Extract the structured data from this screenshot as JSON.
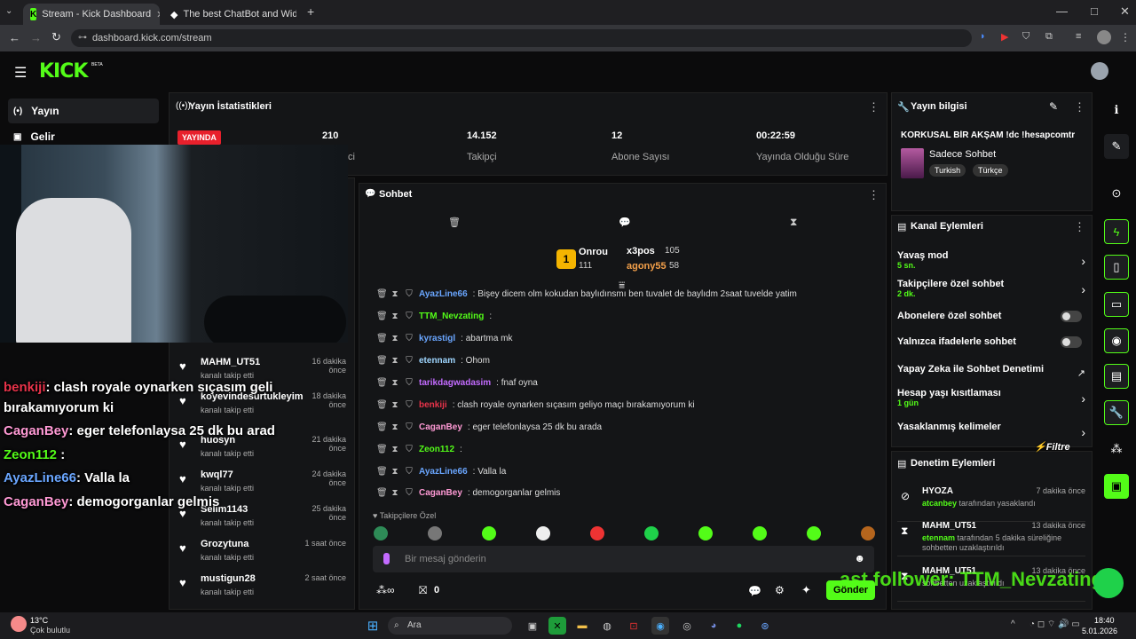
{
  "browser": {
    "tabs": [
      {
        "title": "Stream - Kick Dashboard"
      },
      {
        "title": "The best ChatBot and Widg"
      }
    ],
    "url": "dashboard.kick.com/stream",
    "new_tab": "+",
    "min": "—",
    "max": "□",
    "close": "✕"
  },
  "header": {
    "logo": "KICK",
    "beta": "BETA"
  },
  "sidebar": {
    "items": [
      {
        "label": "Yayın",
        "icon": "broadcast-icon"
      },
      {
        "label": "Gelir",
        "icon": "wallet-icon"
      }
    ]
  },
  "stats": {
    "title": "Yayın İstatistikleri",
    "live_badge": "YAYINDA",
    "items": [
      {
        "value": "210",
        "label": "ci"
      },
      {
        "value": "14.152",
        "label": "Takipçi"
      },
      {
        "value": "12",
        "label": "Abone Sayısı"
      },
      {
        "value": "00:22:59",
        "label": "Yayında Olduğu Süre"
      }
    ]
  },
  "followers": [
    {
      "name": "MAHM_UT51",
      "sub": "kanalı takip etti",
      "time": "16 dakika önce"
    },
    {
      "name": "koyevindesurtukleyim",
      "sub": "kanalı takip etti",
      "time": "18 dakika önce"
    },
    {
      "name": "huosyn",
      "sub": "kanalı takip etti",
      "time": "21 dakika önce"
    },
    {
      "name": "kwql77",
      "sub": "kanalı takip etti",
      "time": "24 dakika önce"
    },
    {
      "name": "Selim1143",
      "sub": "kanalı takip etti",
      "time": "25 dakika önce"
    },
    {
      "name": "Grozytuna",
      "sub": "kanalı takip etti",
      "time": "1 saat önce"
    },
    {
      "name": "mustigun28",
      "sub": "kanalı takip etti",
      "time": "2 saat önce"
    }
  ],
  "overlay": [
    {
      "name": "benkiji",
      "text": ": clash royale oynarken sıçasım geli"
    },
    {
      "name": "",
      "text": "bırakamıyorum ki"
    },
    {
      "name": "CaganBey",
      "text": ": eger telefonlaysa 25 dk bu arad"
    },
    {
      "name": "Zeon112",
      "text": " :"
    },
    {
      "name": "AyazLine66",
      "text": ": Valla la"
    },
    {
      "name": "CaganBey",
      "text": ": demogorganlar gelmis"
    }
  ],
  "chat": {
    "title": "Sohbet",
    "leader": {
      "rank": "1",
      "name": "Onrou",
      "count": "111",
      "second": "x3pos",
      "second_count": "105",
      "third": "agony55",
      "third_count": "58"
    },
    "messages": [
      {
        "user": "AyazLine66",
        "color": "#6aa6ff",
        "text": ": Bişey dicem olm kokudan baylıdınsmı ben tuvalet de baylıdm 2saat tuvelde yatim"
      },
      {
        "user": "TTM_Nevzating",
        "color": "#53fc18",
        "text": ":"
      },
      {
        "user": "kyrastigl",
        "color": "#6aa6ff",
        "text": ": abartma mk"
      },
      {
        "user": "etennam",
        "color": "#9fd6ff",
        "text": ": Ohom"
      },
      {
        "user": "tarikdagwadasim",
        "color": "#c36bff",
        "text": ": fnaf oyna"
      },
      {
        "user": "benkiji",
        "color": "#e8334a",
        "text": ": clash royale oynarken sıçasım geliyo maçı bırakamıyorum ki"
      },
      {
        "user": "CaganBey",
        "color": "#ff9ad5",
        "text": ": eger telefonlaysa 25 dk bu arada"
      },
      {
        "user": "Zeon112",
        "color": "#53fc18",
        "text": ":"
      },
      {
        "user": "AyazLine66",
        "color": "#6aa6ff",
        "text": ": Valla la"
      },
      {
        "user": "CaganBey",
        "color": "#ff9ad5",
        "text": ": demogorganlar gelmis"
      }
    ],
    "followers_only": "Takipçilere Özel",
    "placeholder": "Bir mesaj gönderin",
    "points": "0",
    "send": "Gönder"
  },
  "stream_info": {
    "title": "Yayın bilgisi",
    "stream_title": "KORKUSAL BİR AKŞAM !dc !hesapcomtr",
    "category": "Sadece Sohbet",
    "tags": [
      "Turkish",
      "Türkçe"
    ]
  },
  "channel_actions": {
    "title": "Kanal Eylemleri",
    "rows": [
      {
        "name": "Yavaş mod",
        "sub": "5 sn."
      },
      {
        "name": "Takipçilere özel sohbet",
        "sub": "2 dk."
      },
      {
        "name": "Abonelere özel sohbet",
        "sub": ""
      },
      {
        "name": "Yalnızca ifadelerle sohbet",
        "sub": ""
      },
      {
        "name": "Yapay Zeka ile Sohbet Denetimi",
        "sub": ""
      },
      {
        "name": "Hesap yaşı kısıtlaması",
        "sub": "1 gün"
      },
      {
        "name": "Yasaklanmış kelimeler",
        "sub": ""
      }
    ]
  },
  "mod_actions": {
    "title": "Denetim Eylemleri",
    "rows": [
      {
        "user": "HYOZA",
        "detail": "tarafından yasaklandı",
        "by": "atcanbey",
        "time": "7 dakika önce"
      },
      {
        "user": "MAHM_UT51",
        "detail": "tarafından 5 dakika süreliğine sohbetten uzaklaştırıldı",
        "by": "etennam",
        "time": "13 dakika önce"
      },
      {
        "user": "MAHM_UT51",
        "detail": "sohbetten uzaklaştırıldı",
        "by": "",
        "time": "13 dakika önce"
      }
    ]
  },
  "watermark": "Filtre",
  "overlay_bottom": "ast follower: TTM_Nevzating",
  "taskbar": {
    "temp": "13°C",
    "weather": "Çok bulutlu",
    "search": "Ara",
    "time": "18:40",
    "date": "5.01.2026"
  },
  "colors": {
    "accent": "#53fc18",
    "live": "#e8202c"
  }
}
